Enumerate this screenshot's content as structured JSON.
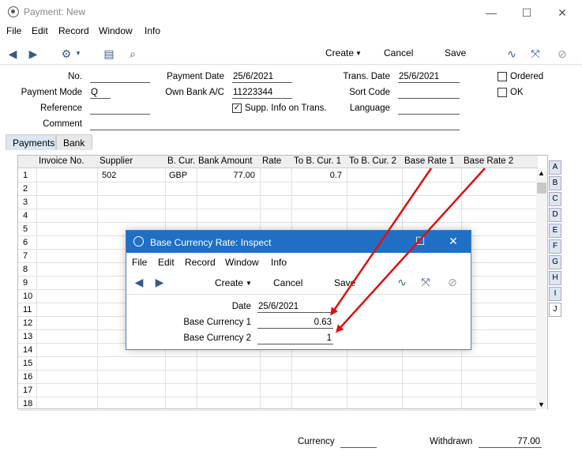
{
  "window": {
    "title": "Payment: New",
    "minimize": "—",
    "maximize": "☐",
    "close": "✕"
  },
  "menu": [
    "File",
    "Edit",
    "Record",
    "Window",
    "Info"
  ],
  "toolbar": {
    "create": "Create",
    "cancel": "Cancel",
    "save": "Save"
  },
  "header": {
    "no_label": "No.",
    "no_value": "",
    "payment_mode_label": "Payment Mode",
    "payment_mode_value": "Q",
    "reference_label": "Reference",
    "reference_value": "",
    "comment_label": "Comment",
    "comment_value": "",
    "payment_date_label": "Payment Date",
    "payment_date_value": "25/6/2021",
    "own_bank_label": "Own Bank A/C",
    "own_bank_value": "11223344",
    "supp_info_label": "Supp. Info on Trans.",
    "supp_info_checked": "✓",
    "trans_date_label": "Trans. Date",
    "trans_date_value": "25/6/2021",
    "sort_code_label": "Sort Code",
    "sort_code_value": "",
    "language_label": "Language",
    "language_value": "",
    "ordered_label": "Ordered",
    "ok_label": "OK"
  },
  "tabs": [
    "Payments",
    "Bank"
  ],
  "grid": {
    "columns": [
      "Invoice No.",
      "Supplier",
      "B. Cur.",
      "Bank Amount",
      "Rate",
      "To B. Cur. 1",
      "To B. Cur. 2",
      "Base Rate 1",
      "Base Rate 2"
    ],
    "rows": [
      {
        "n": "1",
        "supplier": "502",
        "bcur": "GBP",
        "amount": "77.00",
        "tobcur1": "0.7"
      },
      {
        "n": "2"
      },
      {
        "n": "3"
      },
      {
        "n": "4"
      },
      {
        "n": "5"
      },
      {
        "n": "6"
      },
      {
        "n": "7"
      },
      {
        "n": "8"
      },
      {
        "n": "9"
      },
      {
        "n": "10"
      },
      {
        "n": "11"
      },
      {
        "n": "12"
      },
      {
        "n": "13"
      },
      {
        "n": "14"
      },
      {
        "n": "15"
      },
      {
        "n": "16"
      },
      {
        "n": "17"
      },
      {
        "n": "18"
      }
    ]
  },
  "side_tabs": [
    "A",
    "B",
    "C",
    "D",
    "E",
    "F",
    "G",
    "H",
    "I",
    "J"
  ],
  "dialog": {
    "title": "Base Currency Rate: Inspect",
    "menu": [
      "File",
      "Edit",
      "Record",
      "Window",
      "Info"
    ],
    "create": "Create",
    "cancel": "Cancel",
    "save": "Save",
    "date_label": "Date",
    "date_value": "25/6/2021",
    "bc1_label": "Base Currency 1",
    "bc1_value": "0.63",
    "bc2_label": "Base Currency 2",
    "bc2_value": "1"
  },
  "footer": {
    "currency_label": "Currency",
    "currency_value": "",
    "withdrawn_label": "Withdrawn",
    "withdrawn_value": "77.00"
  },
  "colors": {
    "arrow": "#e01010",
    "title_blue": "#1f6fc5"
  }
}
